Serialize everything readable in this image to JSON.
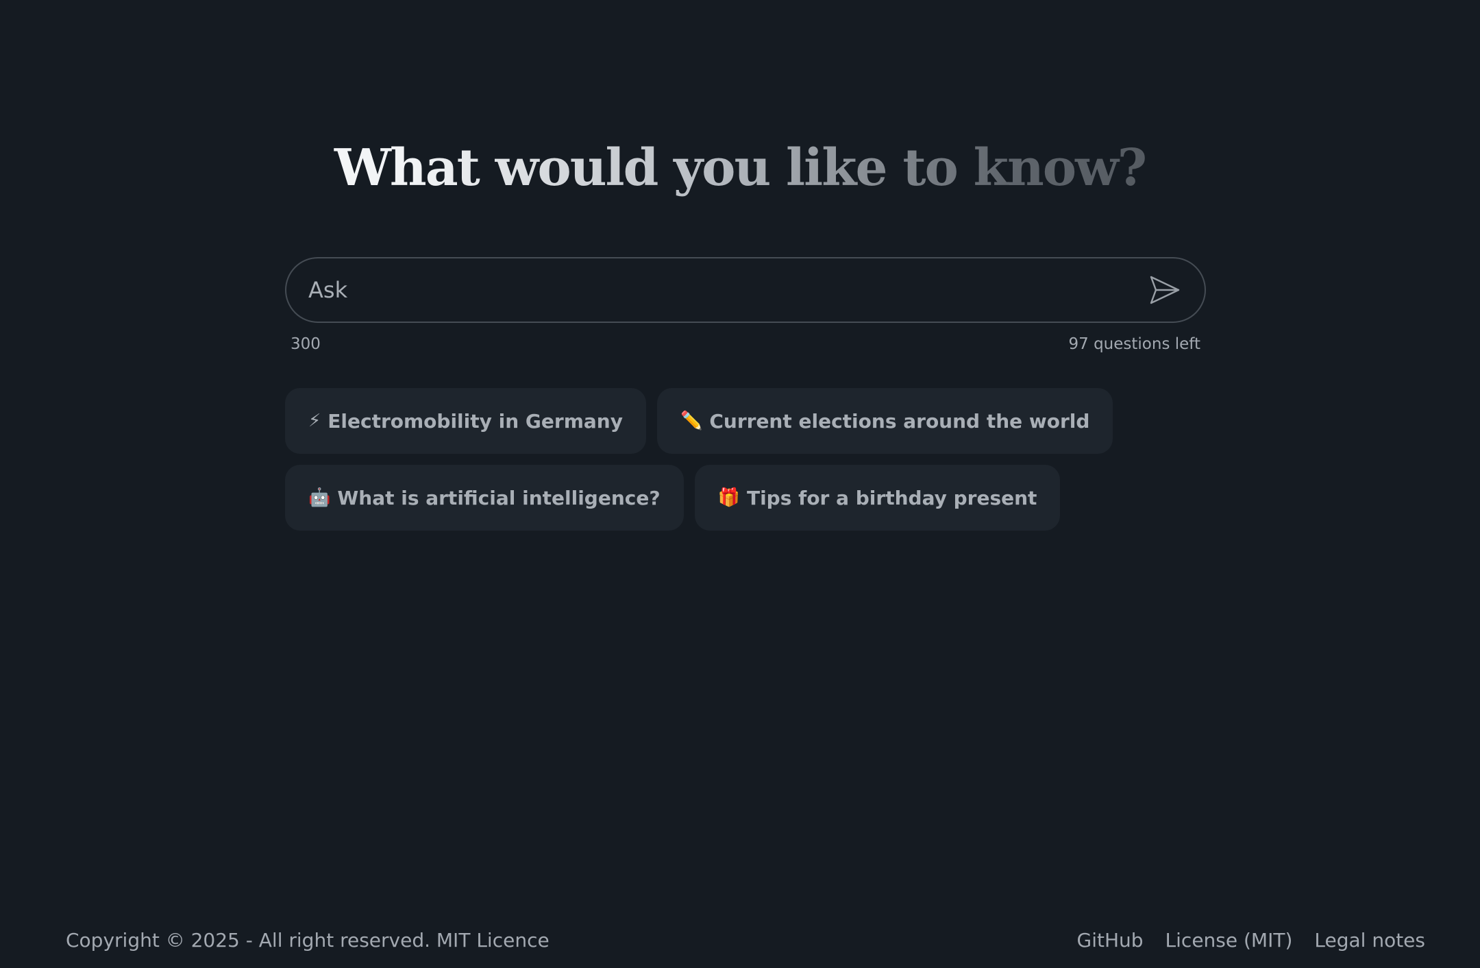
{
  "heading": {
    "title": "What would you like to know?"
  },
  "search": {
    "placeholder": "Ask",
    "value": "",
    "char_limit": "300",
    "questions_left": "97 questions left",
    "send_icon": "paper-plane-icon"
  },
  "suggestions": [
    {
      "emoji": "⚡",
      "label": "Electromobility in Germany"
    },
    {
      "emoji": "✏️",
      "label": "Current elections around the world"
    },
    {
      "emoji": "🤖",
      "label": "What is artificial intelligence?"
    },
    {
      "emoji": "🎁",
      "label": "Tips for a birthday present"
    }
  ],
  "footer": {
    "copyright": "Copyright © 2025 - All right reserved. MIT Licence",
    "links": [
      "GitHub",
      "License (MIT)",
      "Legal notes"
    ]
  },
  "colors": {
    "background": "#151b22",
    "chip": "#1e252d",
    "border": "#454c54",
    "text": "#a3a9b1"
  }
}
